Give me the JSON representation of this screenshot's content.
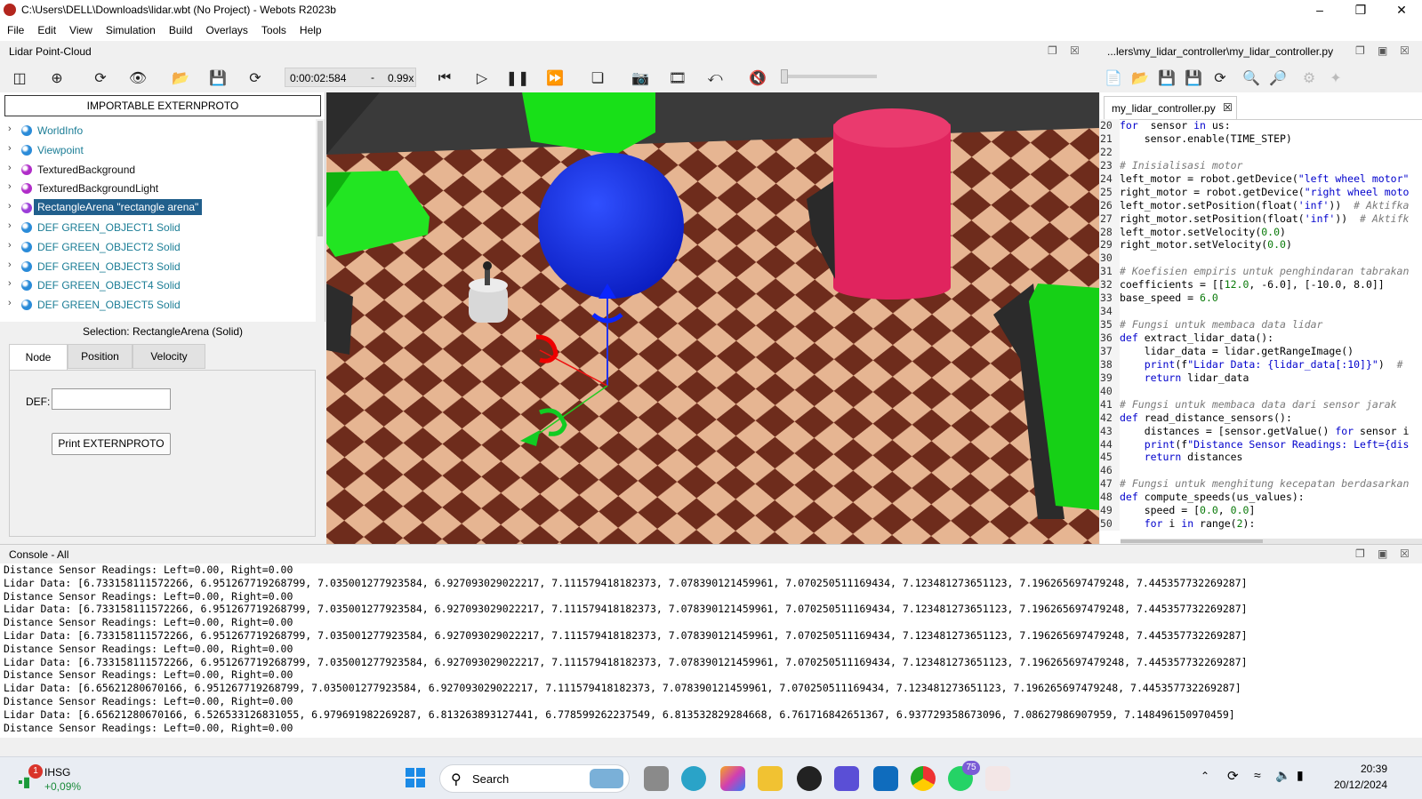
{
  "window": {
    "title": "C:\\Users\\DELL\\Downloads\\lidar.wbt (No Project) - Webots R2023b"
  },
  "menu": [
    "File",
    "Edit",
    "View",
    "Simulation",
    "Build",
    "Overlays",
    "Tools",
    "Help"
  ],
  "panel_title": "Lidar Point-Cloud",
  "editor_path": "...lers\\my_lidar_controller\\my_lidar_controller.py",
  "toolbar": {
    "time": "0:00:02:584",
    "dash": "-",
    "speed": "0.99x"
  },
  "scene_tree": {
    "button": "IMPORTABLE EXTERNPROTO",
    "items": [
      {
        "label": "WorldInfo",
        "color": "#2a8bd8",
        "teal": true
      },
      {
        "label": "Viewpoint",
        "color": "#2a8bd8",
        "teal": true
      },
      {
        "label": "TexturedBackground",
        "color": "#b02cc8",
        "teal": false
      },
      {
        "label": "TexturedBackgroundLight",
        "color": "#b02cc8",
        "teal": false
      },
      {
        "label": "RectangleArena \"rectangle arena\"",
        "color": "#9b3dd8",
        "teal": false,
        "selected": true
      },
      {
        "label": "DEF GREEN_OBJECT1 Solid",
        "color": "#2a8bd8",
        "teal": true
      },
      {
        "label": "DEF GREEN_OBJECT2 Solid",
        "color": "#2a8bd8",
        "teal": true
      },
      {
        "label": "DEF GREEN_OBJECT3 Solid",
        "color": "#2a8bd8",
        "teal": true
      },
      {
        "label": "DEF GREEN_OBJECT4 Solid",
        "color": "#2a8bd8",
        "teal": true
      },
      {
        "label": "DEF GREEN_OBJECT5 Solid",
        "color": "#2a8bd8",
        "teal": true
      }
    ]
  },
  "field_editor": {
    "selection": "Selection: RectangleArena (Solid)",
    "tabs": [
      "Node",
      "Position",
      "Velocity"
    ],
    "def_label": "DEF:",
    "def_value": "",
    "print_button": "Print EXTERNPROTO"
  },
  "editor": {
    "tab": "my_lidar_controller.py",
    "lines": [
      {
        "n": "20",
        "code": [
          [
            "kw",
            "for"
          ],
          [
            "",
            "  sensor "
          ],
          [
            "kw",
            "in"
          ],
          [
            "",
            " us:"
          ]
        ]
      },
      {
        "n": "21",
        "code": [
          [
            "",
            "    sensor.enable(TIME_STEP)"
          ]
        ]
      },
      {
        "n": "22",
        "code": [
          [
            "",
            ""
          ]
        ]
      },
      {
        "n": "23",
        "code": [
          [
            "cm",
            "# Inisialisasi motor"
          ]
        ]
      },
      {
        "n": "24",
        "code": [
          [
            "",
            "left_motor = robot.getDevice("
          ],
          [
            "st",
            "\"left wheel motor\""
          ]
        ]
      },
      {
        "n": "25",
        "code": [
          [
            "",
            "right_motor = robot.getDevice("
          ],
          [
            "st",
            "\"right wheel moto"
          ]
        ]
      },
      {
        "n": "26",
        "code": [
          [
            "",
            "left_motor.setPosition(float("
          ],
          [
            "st",
            "'inf'"
          ],
          [
            "",
            "))  "
          ],
          [
            "cm",
            "# Aktifka"
          ]
        ]
      },
      {
        "n": "27",
        "code": [
          [
            "",
            "right_motor.setPosition(float("
          ],
          [
            "st",
            "'inf'"
          ],
          [
            "",
            "))  "
          ],
          [
            "cm",
            "# Aktifk"
          ]
        ]
      },
      {
        "n": "28",
        "code": [
          [
            "",
            "left_motor.setVelocity("
          ],
          [
            "nm",
            "0.0"
          ],
          [
            "",
            ")"
          ]
        ]
      },
      {
        "n": "29",
        "code": [
          [
            "",
            "right_motor.setVelocity("
          ],
          [
            "nm",
            "0.0"
          ],
          [
            "",
            ")"
          ]
        ]
      },
      {
        "n": "30",
        "code": [
          [
            "",
            ""
          ]
        ]
      },
      {
        "n": "31",
        "code": [
          [
            "cm",
            "# Koefisien empiris untuk penghindaran tabrakan"
          ]
        ]
      },
      {
        "n": "32",
        "code": [
          [
            "",
            "coefficients = [["
          ],
          [
            "nm",
            "12.0"
          ],
          [
            "",
            ", -6.0], [-10.0, 8.0]]"
          ]
        ]
      },
      {
        "n": "33",
        "code": [
          [
            "",
            "base_speed = "
          ],
          [
            "nm",
            "6.0"
          ]
        ]
      },
      {
        "n": "34",
        "code": [
          [
            "",
            ""
          ]
        ]
      },
      {
        "n": "35",
        "code": [
          [
            "cm",
            "# Fungsi untuk membaca data lidar"
          ]
        ]
      },
      {
        "n": "36",
        "code": [
          [
            "kw",
            "def"
          ],
          [
            "",
            " extract_lidar_data():"
          ]
        ]
      },
      {
        "n": "37",
        "code": [
          [
            "",
            "    lidar_data = lidar.getRangeImage()"
          ]
        ]
      },
      {
        "n": "38",
        "code": [
          [
            "",
            "    "
          ],
          [
            "kw",
            "print"
          ],
          [
            "",
            "(f"
          ],
          [
            "st",
            "\"Lidar Data: {lidar_data[:10]}\""
          ],
          [
            "",
            ")  "
          ],
          [
            "cm",
            "#"
          ]
        ]
      },
      {
        "n": "39",
        "code": [
          [
            "",
            "    "
          ],
          [
            "kw",
            "return"
          ],
          [
            "",
            " lidar_data"
          ]
        ]
      },
      {
        "n": "40",
        "code": [
          [
            "",
            ""
          ]
        ]
      },
      {
        "n": "41",
        "code": [
          [
            "cm",
            "# Fungsi untuk membaca data dari sensor jarak"
          ]
        ]
      },
      {
        "n": "42",
        "code": [
          [
            "kw",
            "def"
          ],
          [
            "",
            " read_distance_sensors():"
          ]
        ]
      },
      {
        "n": "43",
        "code": [
          [
            "",
            "    distances = [sensor.getValue() "
          ],
          [
            "kw",
            "for"
          ],
          [
            "",
            " sensor i"
          ]
        ]
      },
      {
        "n": "44",
        "code": [
          [
            "",
            "    "
          ],
          [
            "kw",
            "print"
          ],
          [
            "",
            "(f"
          ],
          [
            "st",
            "\"Distance Sensor Readings: Left={dis"
          ]
        ]
      },
      {
        "n": "45",
        "code": [
          [
            "",
            "    "
          ],
          [
            "kw",
            "return"
          ],
          [
            "",
            " distances"
          ]
        ]
      },
      {
        "n": "46",
        "code": [
          [
            "",
            ""
          ]
        ]
      },
      {
        "n": "47",
        "code": [
          [
            "cm",
            "# Fungsi untuk menghitung kecepatan berdasarkan"
          ]
        ]
      },
      {
        "n": "48",
        "code": [
          [
            "kw",
            "def"
          ],
          [
            "",
            " compute_speeds(us_values):"
          ]
        ]
      },
      {
        "n": "49",
        "code": [
          [
            "",
            "    speed = ["
          ],
          [
            "nm",
            "0.0"
          ],
          [
            "",
            ", "
          ],
          [
            "nm",
            "0.0"
          ],
          [
            "",
            "]"
          ]
        ]
      },
      {
        "n": "50",
        "code": [
          [
            "",
            "    "
          ],
          [
            "kw",
            "for"
          ],
          [
            "",
            " i "
          ],
          [
            "kw",
            "in"
          ],
          [
            "",
            " range("
          ],
          [
            "nm",
            "2"
          ],
          [
            "",
            "):"
          ]
        ]
      }
    ]
  },
  "console": {
    "title": "Console - All",
    "lines": [
      "Distance Sensor Readings: Left=0.00, Right=0.00",
      "Lidar Data: [6.733158111572266, 6.951267719268799, 7.035001277923584, 6.927093029022217, 7.111579418182373, 7.078390121459961, 7.070250511169434, 7.123481273651123, 7.196265697479248, 7.445357732269287]",
      "Distance Sensor Readings: Left=0.00, Right=0.00",
      "Lidar Data: [6.733158111572266, 6.951267719268799, 7.035001277923584, 6.927093029022217, 7.111579418182373, 7.078390121459961, 7.070250511169434, 7.123481273651123, 7.196265697479248, 7.445357732269287]",
      "Distance Sensor Readings: Left=0.00, Right=0.00",
      "Lidar Data: [6.733158111572266, 6.951267719268799, 7.035001277923584, 6.927093029022217, 7.111579418182373, 7.078390121459961, 7.070250511169434, 7.123481273651123, 7.196265697479248, 7.445357732269287]",
      "Distance Sensor Readings: Left=0.00, Right=0.00",
      "Lidar Data: [6.733158111572266, 6.951267719268799, 7.035001277923584, 6.927093029022217, 7.111579418182373, 7.078390121459961, 7.070250511169434, 7.123481273651123, 7.196265697479248, 7.445357732269287]",
      "Distance Sensor Readings: Left=0.00, Right=0.00",
      "Lidar Data: [6.65621280670166, 6.951267719268799, 7.035001277923584, 6.927093029022217, 7.111579418182373, 7.078390121459961, 7.070250511169434, 7.123481273651123, 7.196265697479248, 7.445357732269287]",
      "Distance Sensor Readings: Left=0.00, Right=0.00",
      "Lidar Data: [6.65621280670166, 6.526533126831055, 6.979691982269287, 6.813263893127441, 6.778599262237549, 6.813532829284668, 6.761716842651367, 6.937729358673096, 7.08627986907959, 7.148496150970459]",
      "Distance Sensor Readings: Left=0.00, Right=0.00"
    ]
  },
  "taskbar": {
    "stock_name": "IHSG",
    "stock_change": "+0,09%",
    "stock_badge": "1",
    "search": "Search",
    "whatsapp_badge": "75",
    "time": "20:39",
    "date": "20/12/2024"
  }
}
